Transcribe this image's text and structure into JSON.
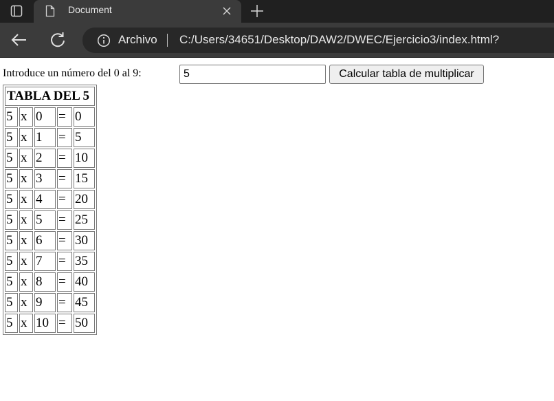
{
  "browser": {
    "tab": {
      "title": "Document"
    },
    "address_bar": {
      "security_label": "Archivo",
      "url": "C:/Users/34651/Desktop/DAW2/DWEC/Ejercicio3/index.html?"
    },
    "theme": {
      "tabbar_bg": "#202020",
      "toolbar_bg": "#3b3b3b",
      "address_bg": "#282828",
      "text": "#e8e8e8"
    }
  },
  "page": {
    "prompt_label": "Introduce un número del 0 al 9:",
    "number_input": {
      "value": "5"
    },
    "calculate_button": "Calcular tabla de multiplicar",
    "table": {
      "title": "TABLA DEL 5",
      "rows": [
        {
          "a": "5",
          "op": "x",
          "b": "0",
          "eq": "=",
          "result": "0"
        },
        {
          "a": "5",
          "op": "x",
          "b": "1",
          "eq": "=",
          "result": "5"
        },
        {
          "a": "5",
          "op": "x",
          "b": "2",
          "eq": "=",
          "result": "10"
        },
        {
          "a": "5",
          "op": "x",
          "b": "3",
          "eq": "=",
          "result": "15"
        },
        {
          "a": "5",
          "op": "x",
          "b": "4",
          "eq": "=",
          "result": "20"
        },
        {
          "a": "5",
          "op": "x",
          "b": "5",
          "eq": "=",
          "result": "25"
        },
        {
          "a": "5",
          "op": "x",
          "b": "6",
          "eq": "=",
          "result": "30"
        },
        {
          "a": "5",
          "op": "x",
          "b": "7",
          "eq": "=",
          "result": "35"
        },
        {
          "a": "5",
          "op": "x",
          "b": "8",
          "eq": "=",
          "result": "40"
        },
        {
          "a": "5",
          "op": "x",
          "b": "9",
          "eq": "=",
          "result": "45"
        },
        {
          "a": "5",
          "op": "x",
          "b": "10",
          "eq": "=",
          "result": "50"
        }
      ]
    }
  }
}
